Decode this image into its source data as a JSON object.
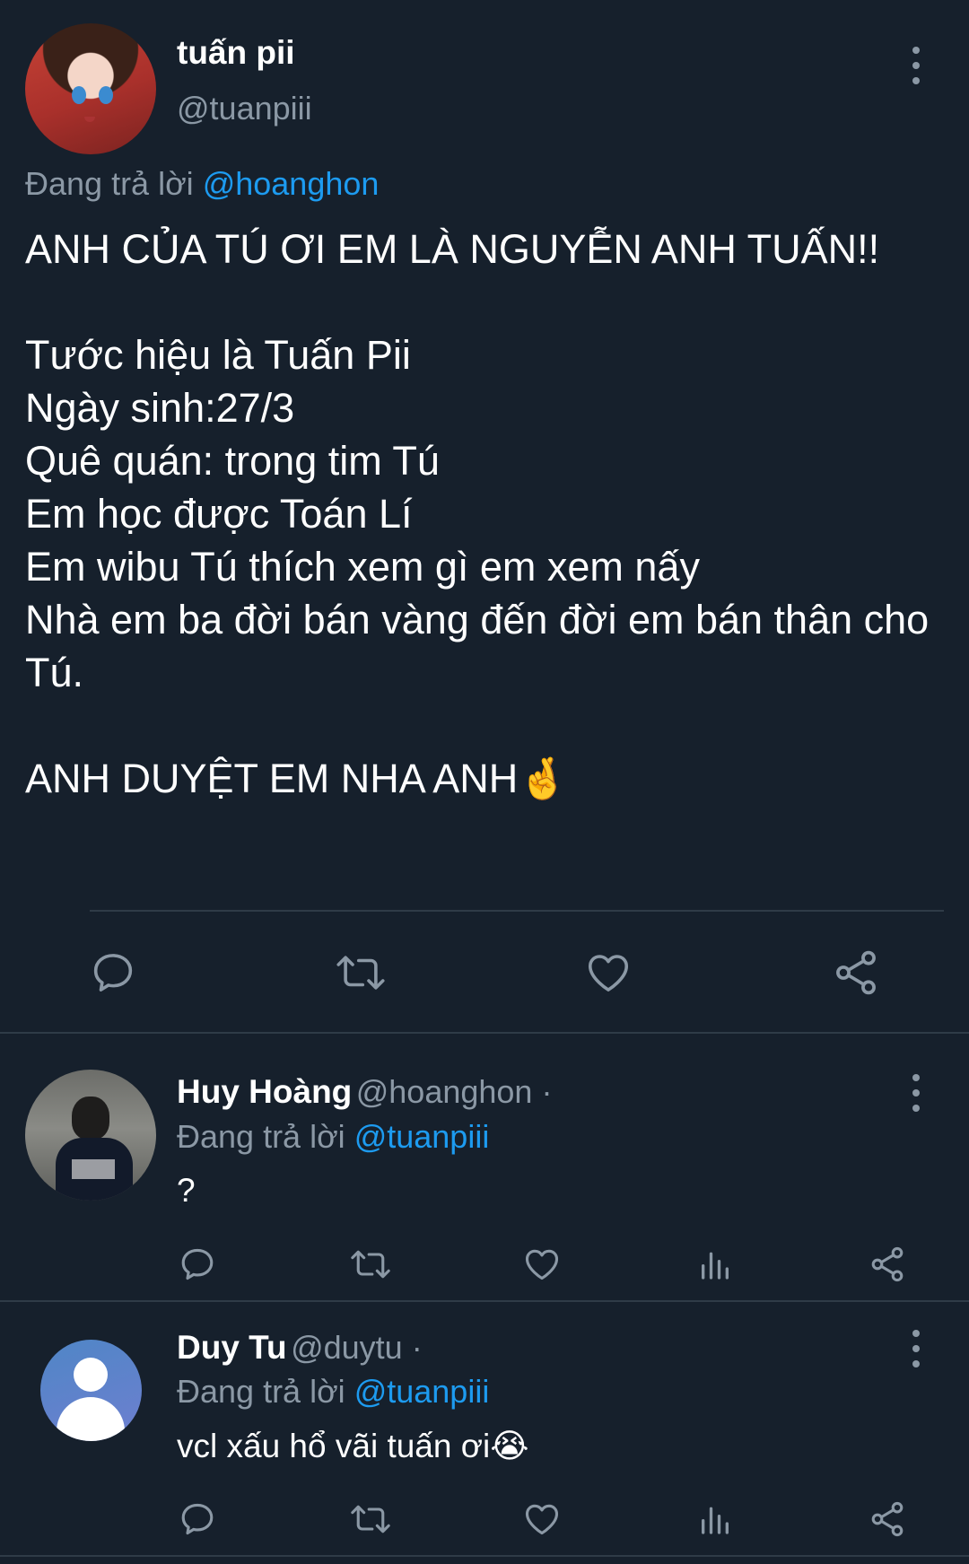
{
  "main_tweet": {
    "display_name": "tuấn pii",
    "handle": "@tuanpiii",
    "replying_prefix": "Đang trả lời ",
    "replying_to": "@hoanghon",
    "body": "ANH CỦA TÚ ƠI EM LÀ NGUYỄN ANH TUẤN!!\n\nTước hiệu là Tuấn Pii\nNgày sinh:27/3\nQuê quán: trong tim Tú\nEm học được Toán Lí\nEm wibu Tú thích xem gì em xem nấy\nNhà em ba đời bán vàng đến đời em bán thân cho Tú.\n\nANH DUYỆT EM NHA ANH🤞"
  },
  "replies": [
    {
      "display_name": "Huy Hoàng",
      "handle": "@hoanghon ·",
      "replying_prefix": "Đang trả lời ",
      "replying_to": "@tuanpiii",
      "text": "?"
    },
    {
      "display_name": "Duy Tu",
      "handle": "@duytu ·",
      "replying_prefix": "Đang trả lời ",
      "replying_to": "@tuanpiii",
      "text": "vcl xấu hổ vãi tuấn ơi😭"
    }
  ],
  "colors": {
    "background": "#16202c",
    "secondary_text": "#8b98a5",
    "link": "#1d9bf0",
    "divider": "#2f3b47"
  },
  "icons": [
    "more-icon",
    "reply-icon",
    "retweet-icon",
    "like-icon",
    "share-icon",
    "analytics-icon"
  ]
}
